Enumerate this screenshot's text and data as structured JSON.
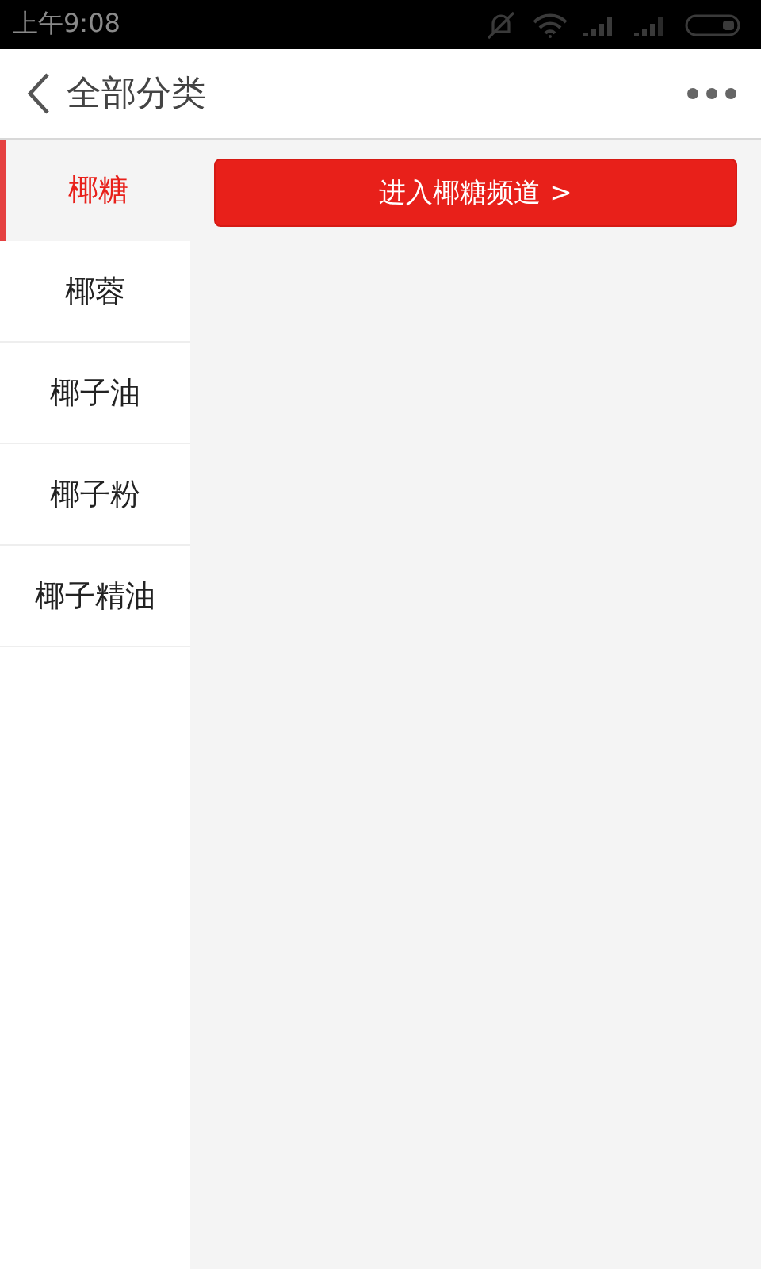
{
  "status_bar": {
    "time": "上午9:08"
  },
  "header": {
    "title": "全部分类"
  },
  "sidebar": {
    "items": [
      {
        "label": "椰糖",
        "selected": true
      },
      {
        "label": "椰蓉",
        "selected": false
      },
      {
        "label": "椰子油",
        "selected": false
      },
      {
        "label": "椰子粉",
        "selected": false
      },
      {
        "label": "椰子精油",
        "selected": false
      }
    ]
  },
  "content": {
    "button": "进入椰糖频道 >"
  }
}
